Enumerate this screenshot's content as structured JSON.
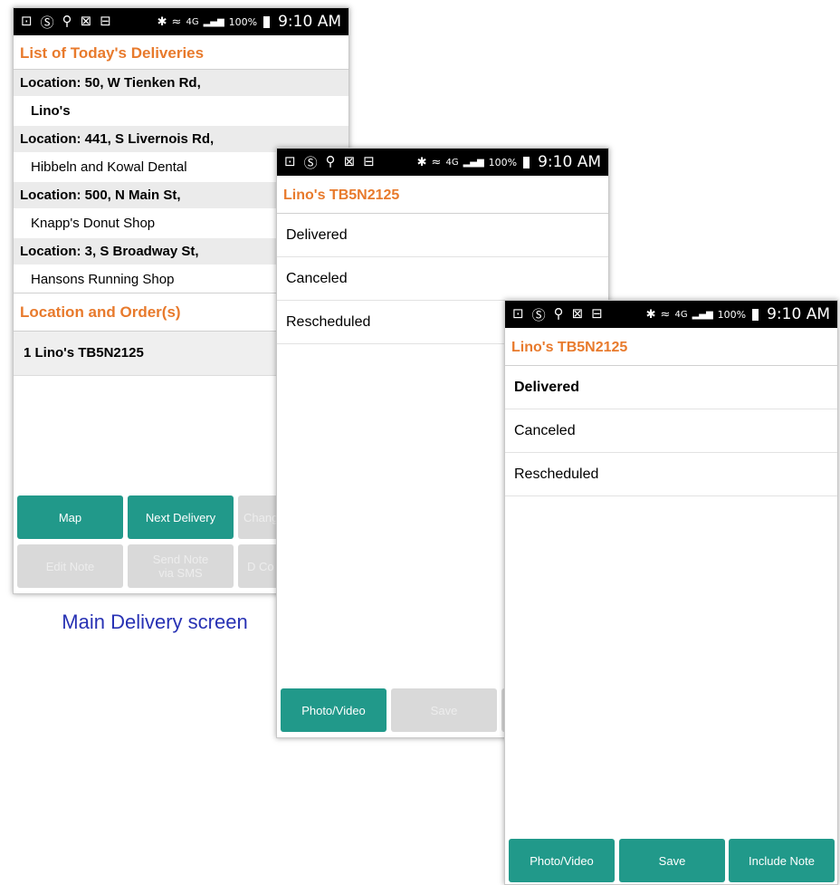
{
  "status_bar": {
    "left_icons": [
      "⊡",
      "Ⓢ",
      "⚲",
      "⊠",
      "⊟"
    ],
    "right_icons": [
      "✱",
      "≈",
      "4G",
      "▂▄▆"
    ],
    "battery": "100%",
    "time": "9:10 AM"
  },
  "screen1": {
    "title": "List of Today's Deliveries",
    "deliveries": [
      {
        "location": "Location: 50, W Tienken Rd,",
        "name": "Lino's",
        "name_bold": true
      },
      {
        "location": "Location: 441, S Livernois Rd,",
        "name": "Hibbeln and Kowal Dental",
        "name_bold": false
      },
      {
        "location": "Location: 500, N Main St,",
        "name": "Knapp's Donut Shop",
        "name_bold": false
      },
      {
        "location": "Location: 3, S Broadway St,",
        "name": "Hansons Running Shop",
        "name_bold": false
      }
    ],
    "orders_header": "Location and Order(s)",
    "order_row": "1  Lino's TB5N2125",
    "buttons": {
      "map": "Map",
      "next_delivery": "Next Delivery",
      "change": "Chang",
      "edit_note": "Edit Note",
      "send_note": "Send Note via SMS",
      "d_co": "D Co"
    },
    "caption": "Main Delivery screen"
  },
  "screen2": {
    "title": "Lino's TB5N2125",
    "options": [
      "Delivered",
      "Canceled",
      "Rescheduled"
    ],
    "buttons": {
      "photo_video": "Photo/Video",
      "save": "Save"
    }
  },
  "screen3": {
    "title": "Lino's TB5N2125",
    "options": [
      "Delivered",
      "Canceled",
      "Rescheduled"
    ],
    "selected": "Delivered",
    "buttons": {
      "photo_video": "Photo/Video",
      "save": "Save",
      "include_note": "Include Note"
    }
  },
  "colors": {
    "accent": "#e87a2c",
    "teal": "#21998a",
    "disabled": "#d9d9d9",
    "caption": "#2832b4"
  }
}
